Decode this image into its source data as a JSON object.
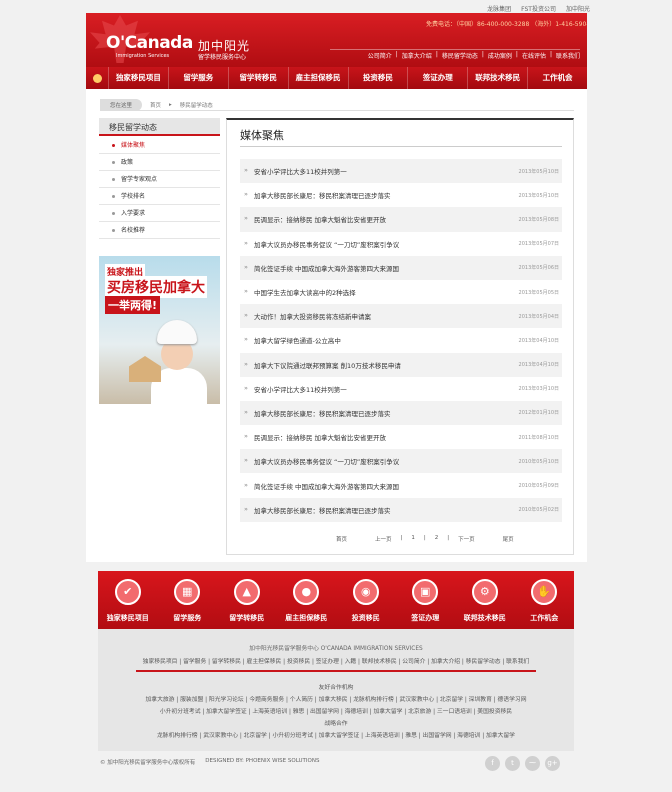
{
  "top_links": [
    "龙脉集团",
    "FST投资公司",
    "加中阳光"
  ],
  "header": {
    "logo_en": "O'Canada",
    "logo_sub": "Immigration Services",
    "logo_cn": "加中阳光",
    "logo_cn_sub": "留学移民服务中心",
    "hotline": "免费电话：（中国）86-400-000-3288    （海外）1-416-590-1576",
    "nav": [
      "公司简介",
      "加拿大介绍",
      "移民留学动态",
      "成功案例",
      "在线评估",
      "联系我们"
    ]
  },
  "main_nav": [
    "独家移民项目",
    "留学服务",
    "留学转移民",
    "雇主担保移民",
    "投资移民",
    "签证办理",
    "联邦技术移民",
    "工作机会"
  ],
  "breadcrumb": {
    "label": "您在这里",
    "home": "首页",
    "current": "移民留学动态"
  },
  "sidebar": {
    "title": "移民留学动态",
    "items": [
      "媒体聚焦",
      "政策",
      "留学专家观点",
      "学校排名",
      "入学要求",
      "名校推荐"
    ]
  },
  "ad": {
    "line1": "独家推出",
    "line2": "买房移民加拿大",
    "line3": "一举两得!"
  },
  "content": {
    "title": "媒体聚焦",
    "news": [
      {
        "title": "安省小学评比大多11校并列第一",
        "date": "2013年05月10日"
      },
      {
        "title": "加拿大移民部长康尼：移民积案清理已逐步落实",
        "date": "2013年05月10日"
      },
      {
        "title": "民调显示：接纳移民 加拿大魁省比安省更开放",
        "date": "2013年05月08日"
      },
      {
        "title": "加拿大议员办移民事务促议 “一刀切”废积案引争议",
        "date": "2013年05月07日"
      },
      {
        "title": "简化签证手续 中国成加拿大海外游客第四大来源国",
        "date": "2013年05月06日"
      },
      {
        "title": "中国学生去加拿大读高中的2种选择",
        "date": "2013年05月05日"
      },
      {
        "title": "大动作！加拿大投资移民将冻结新申请案",
        "date": "2013年05月04日"
      },
      {
        "title": "加拿大留学绿色通道-公立高中",
        "date": "2013年04月10日"
      },
      {
        "title": "加拿大下议院通过联邦预算案 削10万技术移民申请",
        "date": "2013年04月10日"
      },
      {
        "title": "安省小学评比大多11校并列第一",
        "date": "2013年03月10日"
      },
      {
        "title": "加拿大移民部长康尼：移民积案清理已逐步落实",
        "date": "2012年01月10日"
      },
      {
        "title": "民调显示：接纳移民 加拿大魁省比安省更开放",
        "date": "2011年08月10日"
      },
      {
        "title": "加拿大议员办移民事务促议 “一刀切”废积案引争议",
        "date": "2010年05月10日"
      },
      {
        "title": "简化签证手续 中国成加拿大海外游客第四大来源国",
        "date": "2010年05月09日"
      },
      {
        "title": "加拿大移民部长康尼：移民积案清理已逐步落实",
        "date": "2010年05月02日"
      }
    ]
  },
  "pager": {
    "first": "首页",
    "prev": "上一页",
    "p1": "1",
    "p2": "2",
    "next": "下一页",
    "last": "尾页"
  },
  "icon_bar": [
    "独家移民项目",
    "留学服务",
    "留学转移民",
    "雇主担保移民",
    "投资移民",
    "签证办理",
    "联邦技术移民",
    "工作机会"
  ],
  "footer": {
    "company": "加中阳光移民留学服务中心   O'CANADA IMMIGRATION SERVICES",
    "links": "独家移民项目 | 留学服务 | 留学转移民 | 雇主担保移民 | 投资移民 | 签证办理 | 入籍 | 联邦技术移民 | 公司简介 | 加拿大介绍 | 移民留学动态 | 联系我们",
    "partners_title": "友好合作机构",
    "partners1": "加拿大旅游 | 服装加盟 | 阳光学习论坛 | 今题商务服务 | 个人简历 | 加拿大移民 | 龙脉机构排行榜 | 武汉家教中心 | 北京留学 | 深圳教育 | 德语学习网",
    "partners2": "小升初分班考试 | 加拿大留学签证 | 上海英语培训 | 雅思 | 出国留学网 | 海德培训 | 加拿大留学 | 北京旅游 | 三一口语培训 | 美国投资移民",
    "strategic_title": "战略合作",
    "strategic": "龙脉机构排行榜 | 武汉家教中心 | 北京留学 | 小升初分班考试 | 加拿大留学签证 | 上海英语培训 | 雅思 | 出国留学网 | 海德培训 | 加拿大留学",
    "copyright": "© 加中阳光移民留学服务中心版权所有",
    "designer": "DESIGNED BY: PHOENIX WISE SOLUTIONS"
  },
  "colors": {
    "brand_red": "#c8141a",
    "dark_red": "#a30a0f"
  }
}
